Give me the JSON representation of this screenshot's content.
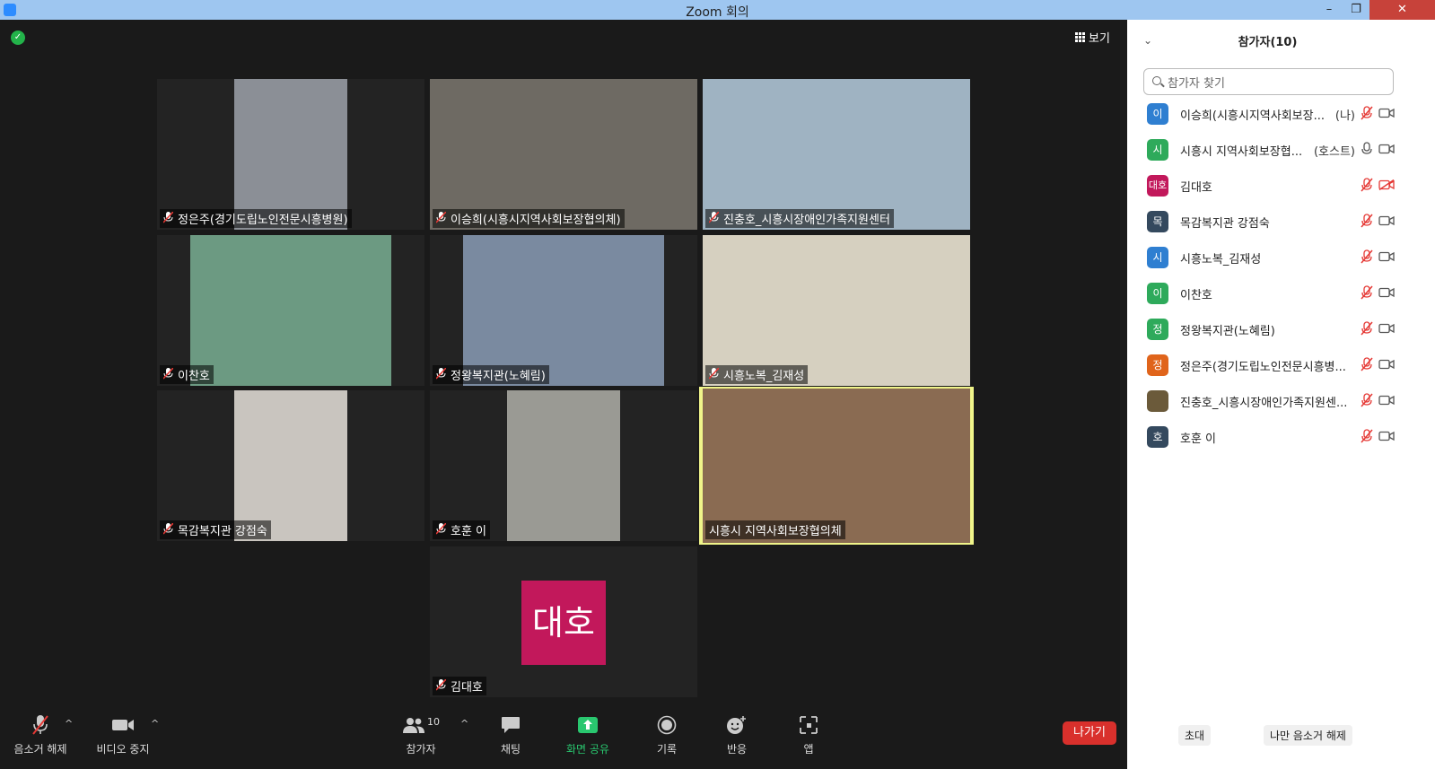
{
  "window": {
    "title": "Zoom 회의",
    "minimize": "–",
    "restore": "❐",
    "close": "✕"
  },
  "meeting": {
    "view_label": "보기",
    "tiles": [
      {
        "name": "정은주(경기도립노인전문시흥병원)",
        "bg": "#8b8f96"
      },
      {
        "name": "이승희(시흥시지역사회보장협의체)",
        "bg": "#6e6a63"
      },
      {
        "name": "진충호_시흥시장애인가족지원센터",
        "bg": "#9fb3c2"
      },
      {
        "name": "이찬호",
        "bg": "#6c9a82"
      },
      {
        "name": "정왕복지관(노혜림)",
        "bg": "#7a8aa0"
      },
      {
        "name": "시흥노복_김재성",
        "bg": "#d6d0c0"
      },
      {
        "name": "목감복지관 강점숙",
        "bg": "#c9c5bf"
      },
      {
        "name": "호훈 이",
        "bg": "#9a9a94"
      },
      {
        "name": "시흥시 지역사회보장협의체",
        "bg": "#8a6b52"
      },
      {
        "name": "김대호",
        "avatar": "대호"
      }
    ]
  },
  "toolbar": {
    "mute_label": "음소거 해제",
    "video_label": "비디오 중지",
    "participants_label": "참가자",
    "participants_count": "10",
    "chat_label": "채팅",
    "share_label": "화면 공유",
    "record_label": "기록",
    "reactions_label": "반응",
    "apps_label": "앱",
    "leave_label": "나가기"
  },
  "panel": {
    "title": "참가자(10)",
    "search_placeholder": "참가자 찾기",
    "participants": [
      {
        "avatar": "이",
        "color": "#2f7fd1",
        "name": "이승희(시흥시지역사회보장...",
        "role": "(나)",
        "mic": "off",
        "cam": "on"
      },
      {
        "avatar": "시",
        "color": "#2eaa5b",
        "name": "시흥시 지역사회보장협...",
        "role": "(호스트)",
        "mic": "on",
        "cam": "on"
      },
      {
        "avatar": "대호",
        "color": "#c2185b",
        "name": "김대호",
        "role": "",
        "mic": "off",
        "cam": "off"
      },
      {
        "avatar": "목",
        "color": "#34495e",
        "name": "목감복지관 강점숙",
        "role": "",
        "mic": "off",
        "cam": "on"
      },
      {
        "avatar": "시",
        "color": "#2f7fd1",
        "name": "시흥노복_김재성",
        "role": "",
        "mic": "off",
        "cam": "on"
      },
      {
        "avatar": "이",
        "color": "#2eaa5b",
        "name": "이찬호",
        "role": "",
        "mic": "off",
        "cam": "on"
      },
      {
        "avatar": "정",
        "color": "#2eaa5b",
        "name": "정왕복지관(노혜림)",
        "role": "",
        "mic": "off",
        "cam": "on"
      },
      {
        "avatar": "정",
        "color": "#e0641b",
        "name": "정은주(경기도립노인전문시흥병...",
        "role": "",
        "mic": "off",
        "cam": "on"
      },
      {
        "avatar": "",
        "color": "#6b5a3a",
        "name": "진충호_시흥시장애인가족지원센...",
        "role": "",
        "mic": "off",
        "cam": "on"
      },
      {
        "avatar": "호",
        "color": "#34495e",
        "name": "호훈 이",
        "role": "",
        "mic": "off",
        "cam": "on"
      }
    ],
    "invite_label": "초대",
    "unmute_me_label": "나만 음소거 해제"
  }
}
